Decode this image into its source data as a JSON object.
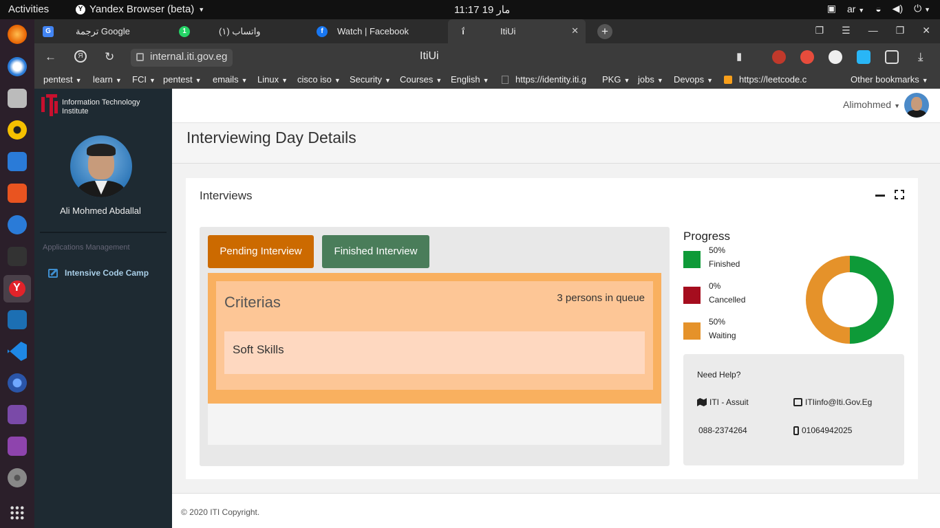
{
  "topbar": {
    "activities": "Activities",
    "app_name": "Yandex Browser (beta)",
    "clock": "مار 19  11:17",
    "lang": "ar"
  },
  "browser": {
    "tabs": [
      {
        "label": "ترجمة Google",
        "icon": "google-translate-icon",
        "color": "#4285f4"
      },
      {
        "label": "(١) واتساب",
        "icon": "whatsapp-icon",
        "color": "#25d366"
      },
      {
        "label": "Watch | Facebook",
        "icon": "facebook-icon",
        "color": "#1877f2"
      },
      {
        "label": "ItiUi",
        "icon": "iti-icon",
        "color": "#eeeeee"
      }
    ],
    "url": "internal.iti.gov.eg",
    "page_title": "ItiUi",
    "bookmarks": [
      {
        "label": "pentest",
        "folder": true
      },
      {
        "label": "learn",
        "folder": true
      },
      {
        "label": "FCI",
        "folder": true
      },
      {
        "label": "pentest",
        "folder": true
      },
      {
        "label": "emails",
        "folder": true
      },
      {
        "label": "Linux",
        "folder": true
      },
      {
        "label": "cisco iso",
        "folder": true
      },
      {
        "label": "Security",
        "folder": true
      },
      {
        "label": "Courses",
        "folder": true
      },
      {
        "label": "English",
        "folder": true
      },
      {
        "label": "https://identity.iti.g",
        "folder": false
      },
      {
        "label": "PKG",
        "folder": true
      },
      {
        "label": "jobs",
        "folder": true
      },
      {
        "label": "Devops",
        "folder": true
      },
      {
        "label": "https://leetcode.c",
        "folder": false
      }
    ],
    "other_bookmarks": "Other bookmarks"
  },
  "sidebar": {
    "logo_text_1": "Information Technology",
    "logo_text_2": "Institute",
    "user_full_name": "Ali Mohmed Abdallal",
    "section": "Applications Management",
    "menu_item": "Intensive Code Camp"
  },
  "header": {
    "username": "Alimohmed"
  },
  "page": {
    "title": "Interviewing Day Details",
    "box_title": "Interviews",
    "pending_label": "Pending Interview",
    "finished_label": "Finished Interview",
    "criterias_label": "Criterias",
    "queue_text": "3 persons in queue",
    "skill": "Soft Skills"
  },
  "progress": {
    "title": "Progress",
    "items": [
      {
        "pct": "50%",
        "label": "Finished",
        "value": 50,
        "color": "#0e9a38"
      },
      {
        "pct": "0%",
        "label": "Cancelled",
        "value": 0,
        "color": "#a50d1e"
      },
      {
        "pct": "50%",
        "label": "Waiting",
        "value": 50,
        "color": "#e5922a"
      }
    ]
  },
  "help": {
    "title": "Need Help?",
    "location": "ITI - Assuit",
    "email": "ITIinfo@Iti.Gov.Eg",
    "phone": "088-2374264",
    "mobile": "01064942025"
  },
  "footer": {
    "copyright": "© 2020 ITI Copyright."
  }
}
